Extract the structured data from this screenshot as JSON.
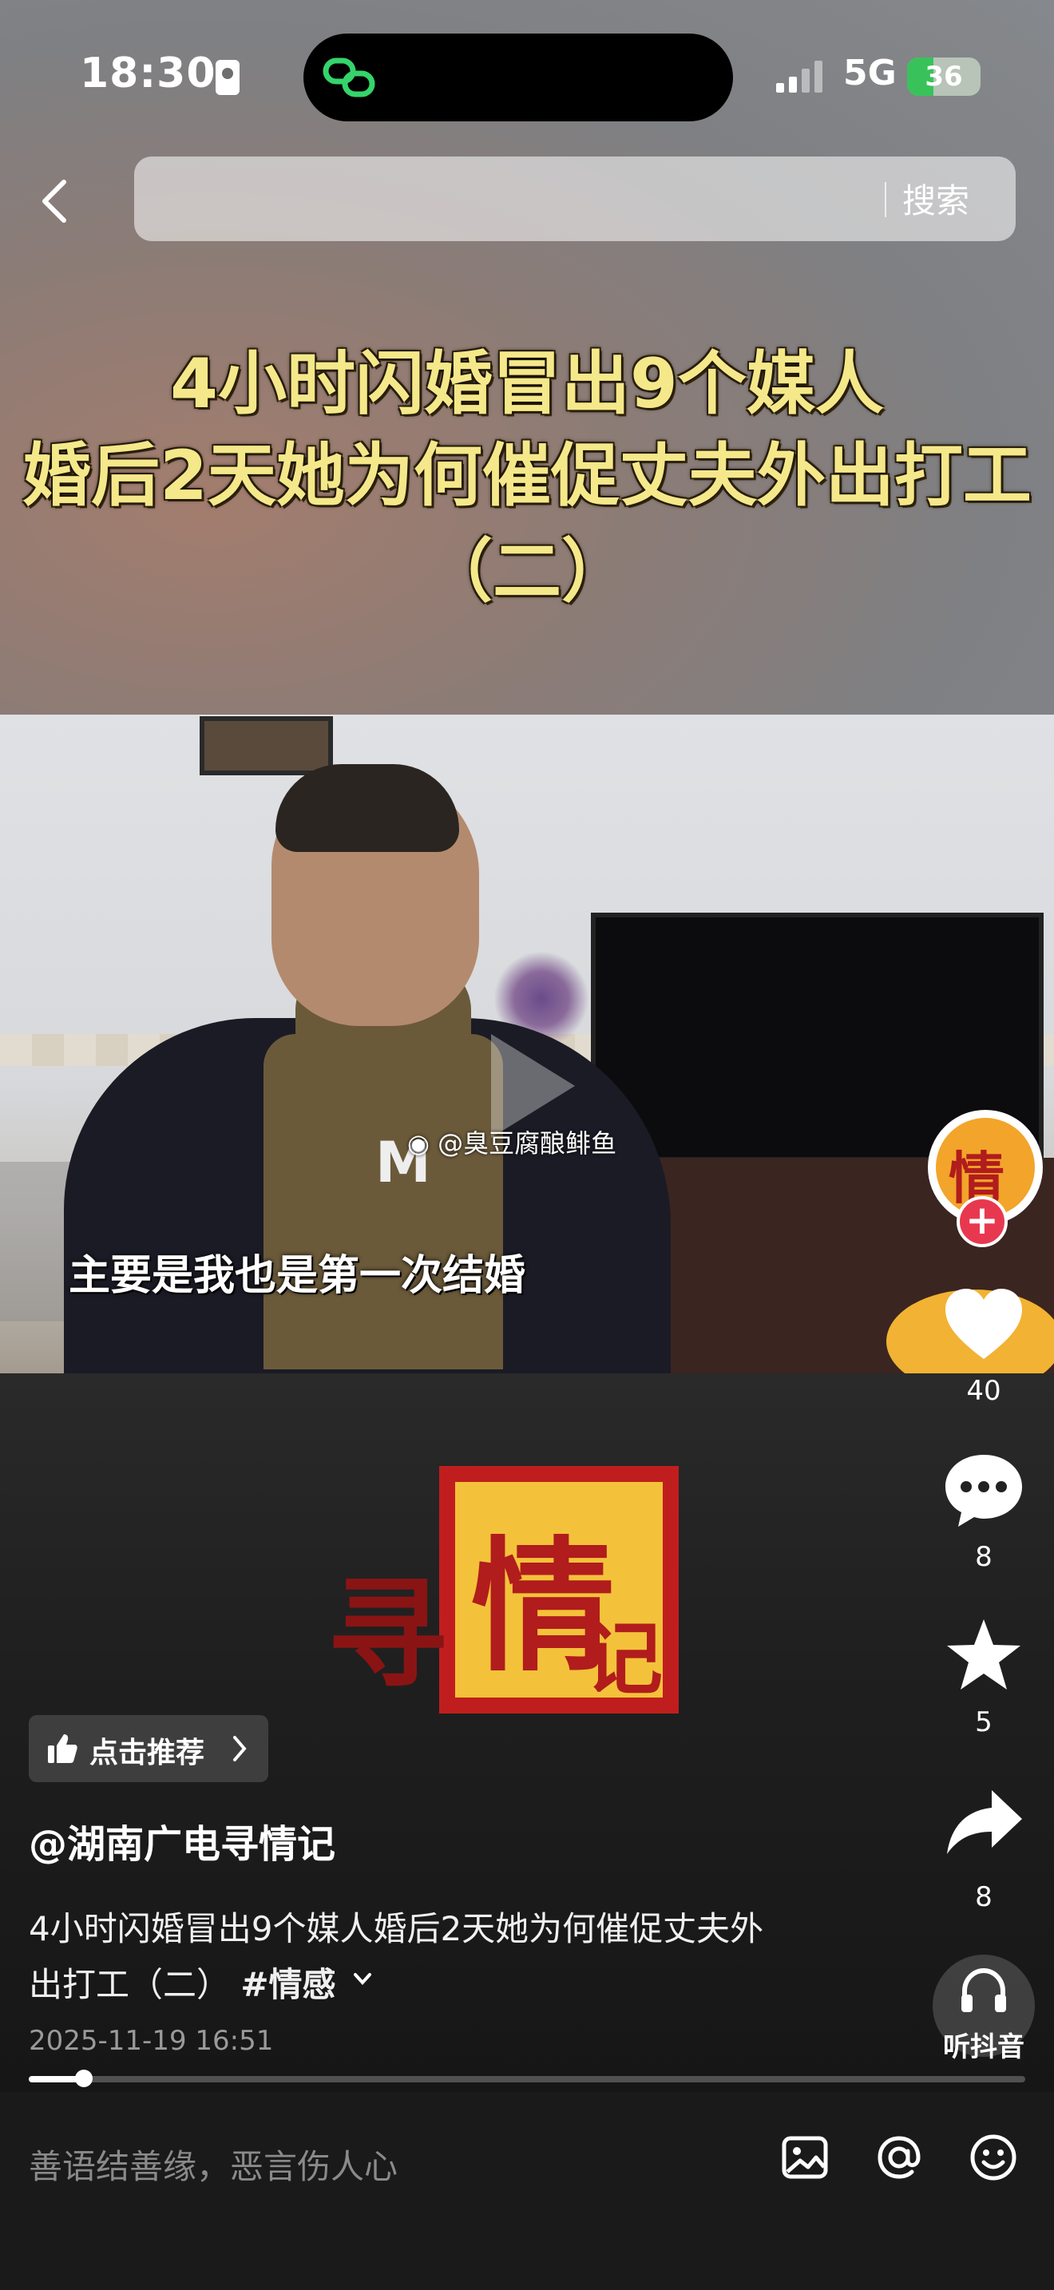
{
  "status_bar": {
    "time": "18:30",
    "network": "5G",
    "battery": "36"
  },
  "search": {
    "placeholder": "",
    "button_label": "搜索"
  },
  "video": {
    "title_lines": [
      "4小时闪婚冒出9个媒人",
      "婚后2天她为何催促丈夫外出打工",
      "（二）"
    ],
    "watermark": "@臭豆腐酿鲱鱼",
    "subtitle": "主要是我也是第一次结婚",
    "logo_text": [
      "寻",
      "情",
      "记"
    ],
    "sweater_text": "M",
    "progress_fraction": 0.055
  },
  "recommend": {
    "label": "点击推荐"
  },
  "post": {
    "author": "@湖南广电寻情记",
    "description_line1": "4小时闪婚冒出9个媒人婚后2天她为何催促丈夫外",
    "description_line2": "出打工（二） ",
    "hashtag": "#情感",
    "date": "2025-11-19 16:51"
  },
  "rail": {
    "avatar_text": "情",
    "follow_symbol": "+",
    "likes": "40",
    "comments": "8",
    "favorites": "5",
    "shares": "8",
    "listen_label": "听抖音"
  },
  "comment_bar": {
    "placeholder": "善语结善缘，恶言伤人心"
  },
  "icons": {
    "back": "chevron-left-icon",
    "like": "heart-icon",
    "comment": "chat-bubble-icon",
    "favorite": "star-icon",
    "share": "share-arrow-icon",
    "listen": "headphones-icon",
    "image": "image-icon",
    "mention": "at-icon",
    "emoji": "emoji-icon"
  }
}
